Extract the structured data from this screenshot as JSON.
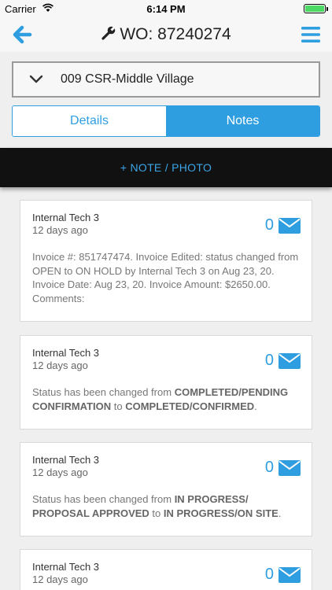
{
  "status_bar": {
    "carrier": "Carrier",
    "time": "6:14 PM",
    "battery_level": 1.0
  },
  "nav": {
    "title": "WO: 87240274",
    "back_icon": "arrow-left-icon",
    "menu_icon": "hamburger-menu-icon",
    "title_icon": "wrench-icon"
  },
  "location": {
    "value": "009 CSR-Middle Village"
  },
  "tabs": [
    {
      "label": "Details",
      "selected": false
    },
    {
      "label": "Notes",
      "selected": true
    }
  ],
  "add_note": {
    "label": "+ NOTE / PHOTO"
  },
  "notes": [
    {
      "author": "Internal Tech 3",
      "time": "12 days ago",
      "count": "0",
      "text": "Invoice #: 851747474. Invoice Edited: status changed from OPEN to ON HOLD by Internal Tech 3 on Aug 23, 20. Invoice Date: Aug 23, 20. Invoice Amount: $2650.00. Comments:"
    },
    {
      "author": "Internal Tech 3",
      "time": "12 days ago",
      "count": "0",
      "prefix": "Status has been changed from ",
      "from": "COMPLETED/PENDING CONFIRMATION",
      "mid": " to ",
      "to": "COMPLETED/CONFIRMED",
      "suffix": "."
    },
    {
      "author": "Internal Tech 3",
      "time": "12 days ago",
      "count": "0",
      "prefix": "Status has been changed from ",
      "from": "IN PROGRESS/ PROPOSAL APPROVED",
      "mid": " to ",
      "to": "IN PROGRESS/ON SITE",
      "suffix": "."
    },
    {
      "author": "Internal Tech 3",
      "time": "12 days ago",
      "count": "0"
    }
  ],
  "colors": {
    "accent": "#2f9ee0",
    "bar": "#111111",
    "background": "#efefef"
  }
}
